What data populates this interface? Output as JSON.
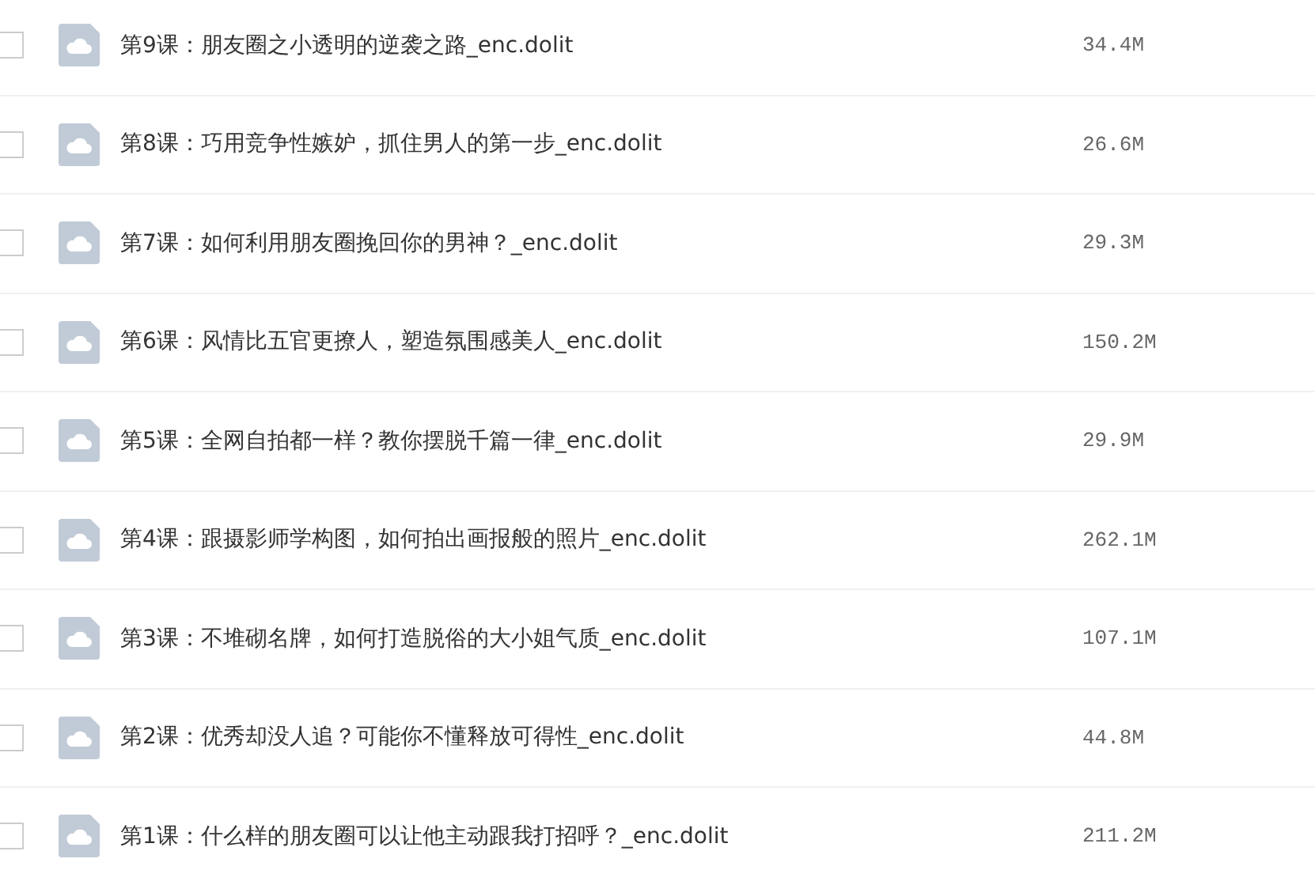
{
  "files": [
    {
      "name": "第9课：朋友圈之小透明的逆袭之路_enc.dolit",
      "size": "34.4M",
      "checked": false
    },
    {
      "name": "第8课：巧用竞争性嫉妒，抓住男人的第一步_enc.dolit",
      "size": "26.6M",
      "checked": false
    },
    {
      "name": "第7课：如何利用朋友圈挽回你的男神？_enc.dolit",
      "size": "29.3M",
      "checked": false
    },
    {
      "name": "第6课：风情比五官更撩人，塑造氛围感美人_enc.dolit",
      "size": "150.2M",
      "checked": false
    },
    {
      "name": "第5课：全网自拍都一样？教你摆脱千篇一律_enc.dolit",
      "size": "29.9M",
      "checked": false
    },
    {
      "name": "第4课：跟摄影师学构图，如何拍出画报般的照片_enc.dolit",
      "size": "262.1M",
      "checked": false
    },
    {
      "name": "第3课：不堆砌名牌，如何打造脱俗的大小姐气质_enc.dolit",
      "size": "107.1M",
      "checked": false
    },
    {
      "name": "第2课：优秀却没人追？可能你不懂释放可得性_enc.dolit",
      "size": "44.8M",
      "checked": false
    },
    {
      "name": "第1课：什么样的朋友圈可以让他主动跟我打招呼？_enc.dolit",
      "size": "211.2M",
      "checked": false
    }
  ]
}
